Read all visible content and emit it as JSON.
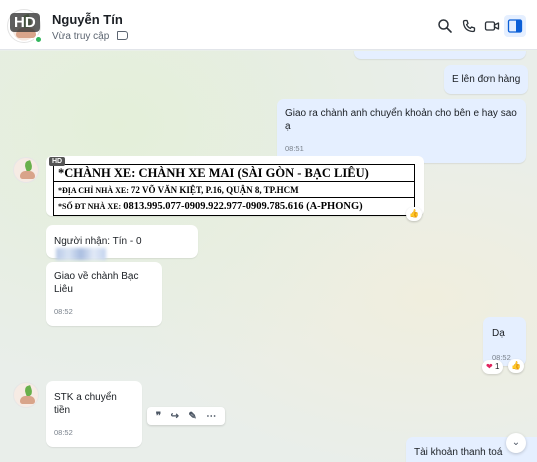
{
  "header": {
    "hd_badge": "HD",
    "contact_name": "Nguyễn Tín",
    "status": "Vừa truy cập"
  },
  "messages": {
    "m1": {
      "text": "E lên đơn hàng"
    },
    "m2": {
      "text": "Giao ra chành anh chuyển khoản cho bên e hay sao ạ",
      "time": "08:51"
    },
    "image": {
      "hd_badge": "HD",
      "line1": "*CHÀNH XE: CHÀNH XE MAI (SÀI GÒN - BẠC LIÊU)",
      "line2_label": "*ĐỊA CHỈ NHÀ XE:",
      "line2_value": "72 VÕ VĂN KIỆT, P.16, QUẬN 8, TP.HCM",
      "line3_label": "*SỐ ĐT NHÀ XE:",
      "line3_value": "0813.995.077-0909.922.977-0909.785.616 (A-PHONG)"
    },
    "m3": {
      "text": "Người nhận: Tín - 0"
    },
    "m4": {
      "text": "Giao về chành Bạc Liêu",
      "time": "08:52"
    },
    "m5": {
      "text": "Dạ",
      "time": "08:52",
      "reaction_count": "1"
    },
    "m6": {
      "text": "STK  a chuyển tiền",
      "time": "08:52"
    },
    "m7": {
      "text": "Tài khoản thanh toá"
    }
  }
}
